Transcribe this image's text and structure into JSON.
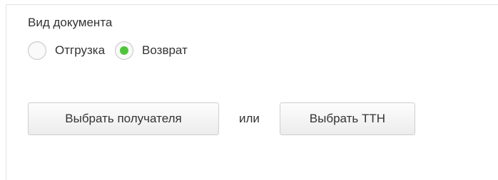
{
  "document_type": {
    "title": "Вид документа",
    "options": [
      {
        "label": "Отгрузка",
        "selected": false
      },
      {
        "label": "Возврат",
        "selected": true
      }
    ],
    "selected_color": "#4fc43a"
  },
  "actions": {
    "choose_recipient_label": "Выбрать получателя",
    "or_label": "или",
    "choose_ttn_label": "Выбрать ТТН"
  }
}
